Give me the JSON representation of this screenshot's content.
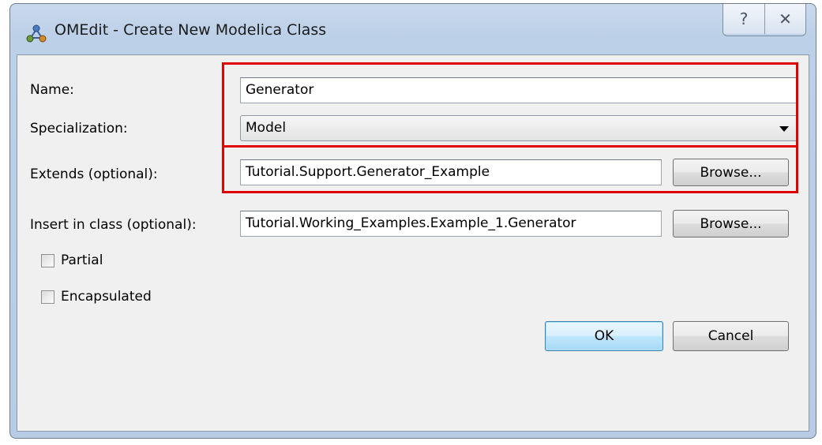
{
  "window": {
    "title": "OMEdit - Create New Modelica Class",
    "help_symbol": "?",
    "close_symbol": "✕"
  },
  "form": {
    "name_label": "Name:",
    "name_value": "Generator",
    "specialization_label": "Specialization:",
    "specialization_value": "Model",
    "extends_label": "Extends (optional):",
    "extends_value": "Tutorial.Support.Generator_Example",
    "extends_browse": "Browse...",
    "insert_label": "Insert in class (optional):",
    "insert_value": "Tutorial.Working_Examples.Example_1.Generator",
    "insert_browse": "Browse...",
    "partial_label": "Partial",
    "partial_checked": false,
    "encapsulated_label": "Encapsulated",
    "encapsulated_checked": false
  },
  "buttons": {
    "ok": "OK",
    "cancel": "Cancel"
  },
  "colors": {
    "highlight": "#e00000",
    "title_bar": "#bcd0e8",
    "dialog_bg": "#f0f0f0"
  }
}
